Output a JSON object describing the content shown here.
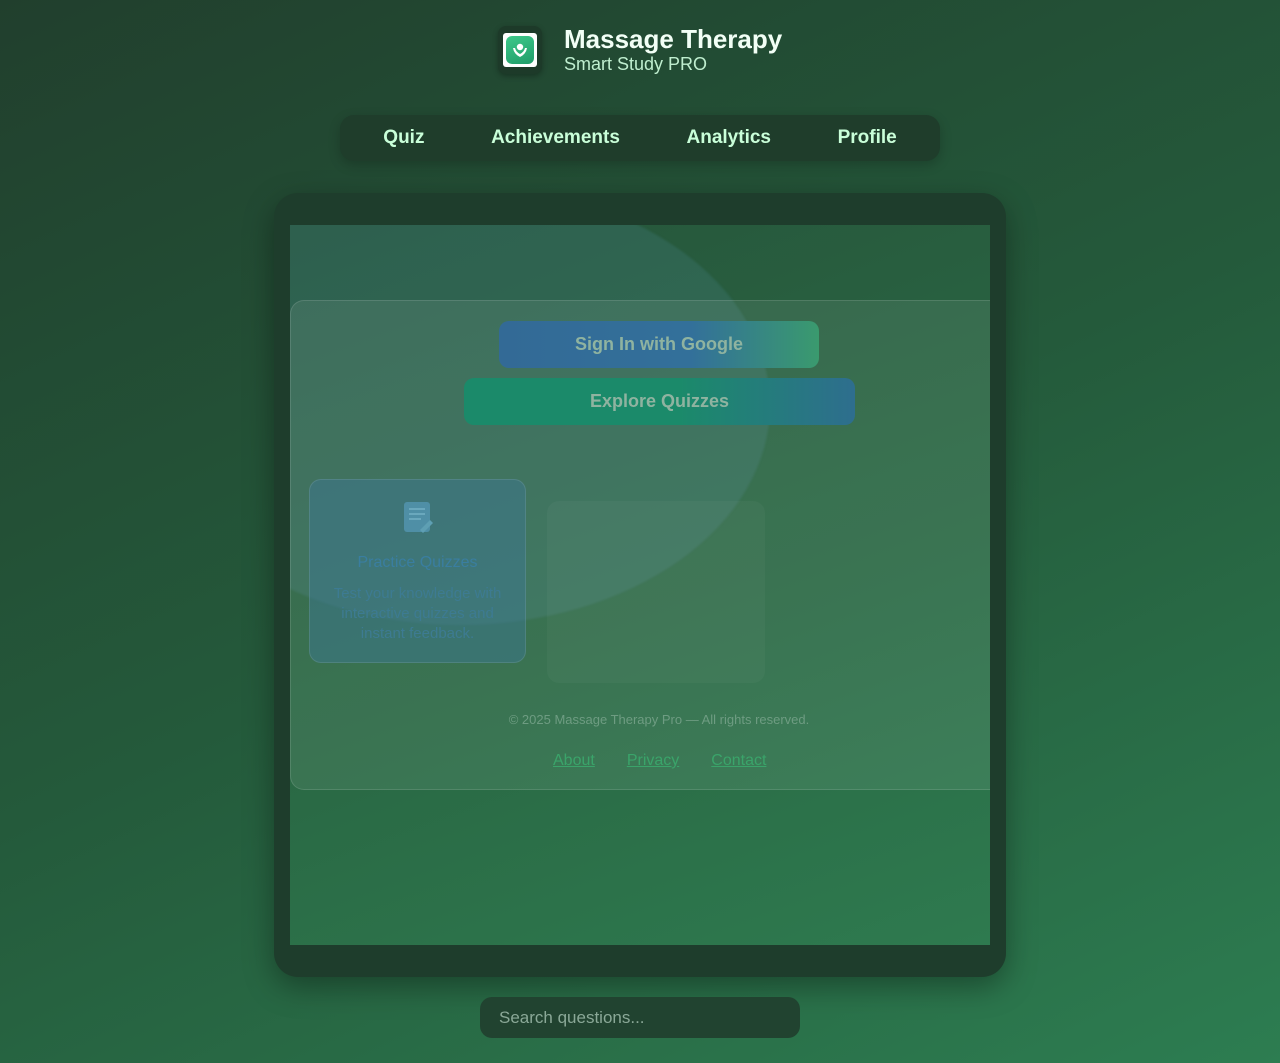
{
  "app": {
    "title": "Massage Therapy",
    "subtitle": "Smart Study PRO",
    "logo_icon": "massage-hands-icon"
  },
  "nav": {
    "items": [
      {
        "label": "Quiz"
      },
      {
        "label": "Achievements"
      },
      {
        "label": "Analytics"
      },
      {
        "label": "Profile"
      }
    ]
  },
  "hero": {
    "google_button": "Sign In with Google",
    "explore_button": "Explore Quizzes"
  },
  "feature": {
    "icon": "memo-icon",
    "title": "Practice Quizzes",
    "description": "Test your knowledge with interactive quizzes and instant feedback."
  },
  "footer": {
    "copyright": "© 2025 Massage Therapy Pro — All rights reserved.",
    "links": [
      "About",
      "Privacy",
      "Contact"
    ]
  },
  "search": {
    "placeholder": "Search questions..."
  },
  "colors": {
    "accent": "#2e7d51",
    "nav_text": "#c9ffd9"
  }
}
